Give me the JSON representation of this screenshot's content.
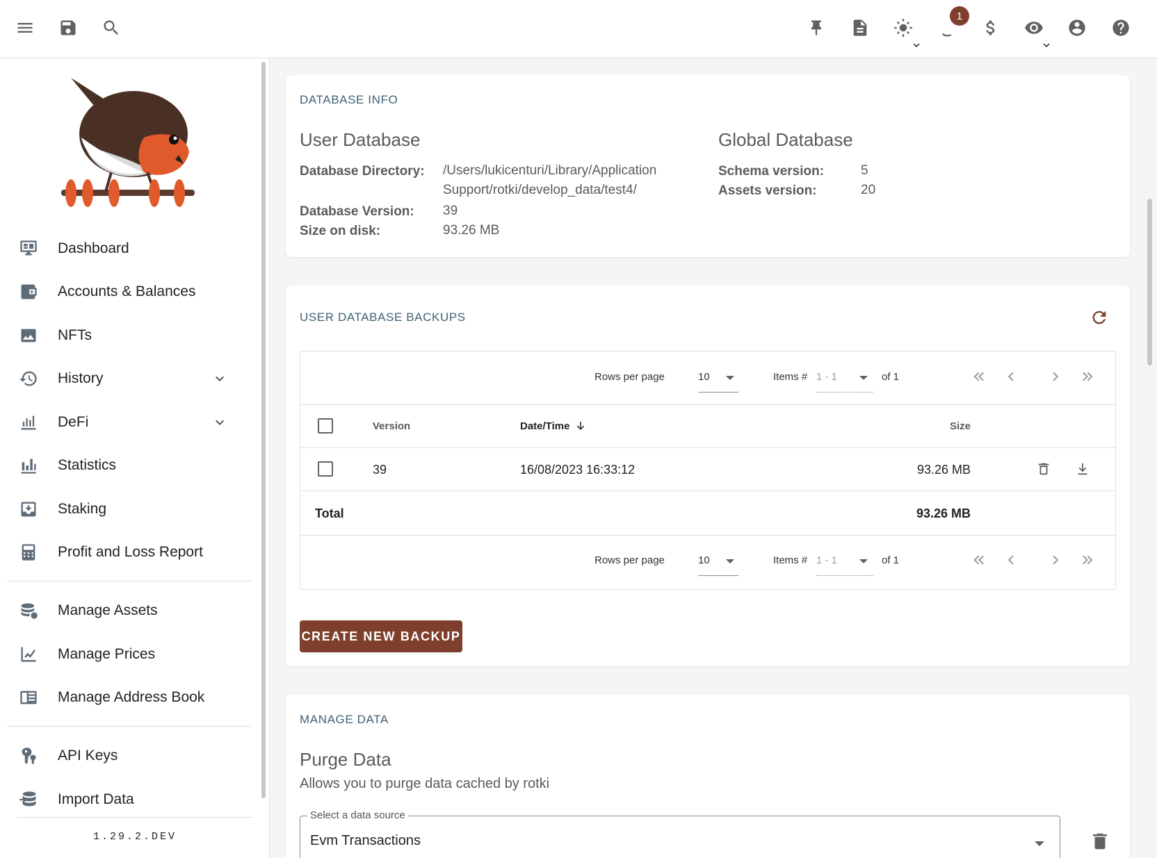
{
  "topbar": {
    "notification_count": "1",
    "icons": [
      "menu-icon",
      "save-icon",
      "search-icon",
      "pin-icon",
      "notes-icon",
      "theme-icon",
      "progress-icon",
      "currency-icon",
      "privacy-eye-icon",
      "account-icon",
      "help-icon"
    ]
  },
  "sidebar": {
    "items": [
      {
        "label": "Dashboard",
        "icon": "dashboard-icon"
      },
      {
        "label": "Accounts & Balances",
        "icon": "wallet-icon"
      },
      {
        "label": "NFTs",
        "icon": "image-icon"
      },
      {
        "label": "History",
        "icon": "history-icon",
        "expandable": true
      },
      {
        "label": "DeFi",
        "icon": "defi-chart-icon",
        "expandable": true
      },
      {
        "label": "Statistics",
        "icon": "bar-chart-icon"
      },
      {
        "label": "Staking",
        "icon": "staking-icon"
      },
      {
        "label": "Profit and Loss Report",
        "icon": "calculator-icon"
      },
      {
        "label": "Manage Assets",
        "icon": "coins-icon"
      },
      {
        "label": "Manage Prices",
        "icon": "line-chart-icon"
      },
      {
        "label": "Manage Address Book",
        "icon": "address-book-icon"
      },
      {
        "label": "API Keys",
        "icon": "keys-icon"
      },
      {
        "label": "Import Data",
        "icon": "import-icon"
      }
    ],
    "version": "1.29.2.DEV"
  },
  "database_info": {
    "title": "DATABASE INFO",
    "user_db": {
      "heading": "User Database",
      "directory_label": "Database Directory:",
      "directory_line1": "/Users/lukicenturi/Library/Application",
      "directory_line2": "Support/rotki/develop_data/test4/",
      "version_label": "Database Version:",
      "version_value": "39",
      "size_label": "Size on disk:",
      "size_value": "93.26 MB"
    },
    "global_db": {
      "heading": "Global Database",
      "schema_label": "Schema version:",
      "schema_value": "5",
      "assets_label": "Assets version:",
      "assets_value": "20"
    }
  },
  "backups": {
    "title": "USER DATABASE BACKUPS",
    "pagination": {
      "rows_per_page_label": "Rows per page",
      "rows_per_page_value": "10",
      "items_label": "Items #",
      "items_range": "1 - 1",
      "of_label": "of 1"
    },
    "columns": {
      "version": "Version",
      "datetime": "Date/Time",
      "size": "Size"
    },
    "rows": [
      {
        "version": "39",
        "datetime": "16/08/2023 16:33:12",
        "size": "93.26 MB"
      }
    ],
    "total_label": "Total",
    "total_value": "93.26 MB",
    "create_button": "CREATE NEW BACKUP"
  },
  "manage_data": {
    "title": "MANAGE DATA",
    "purge_heading": "Purge Data",
    "purge_description": "Allows you to purge data cached by rotki",
    "select_label": "Select a data source",
    "select_value": "Evm Transactions"
  },
  "colors": {
    "accent": "#7e3f2c",
    "title": "#3e6075"
  }
}
